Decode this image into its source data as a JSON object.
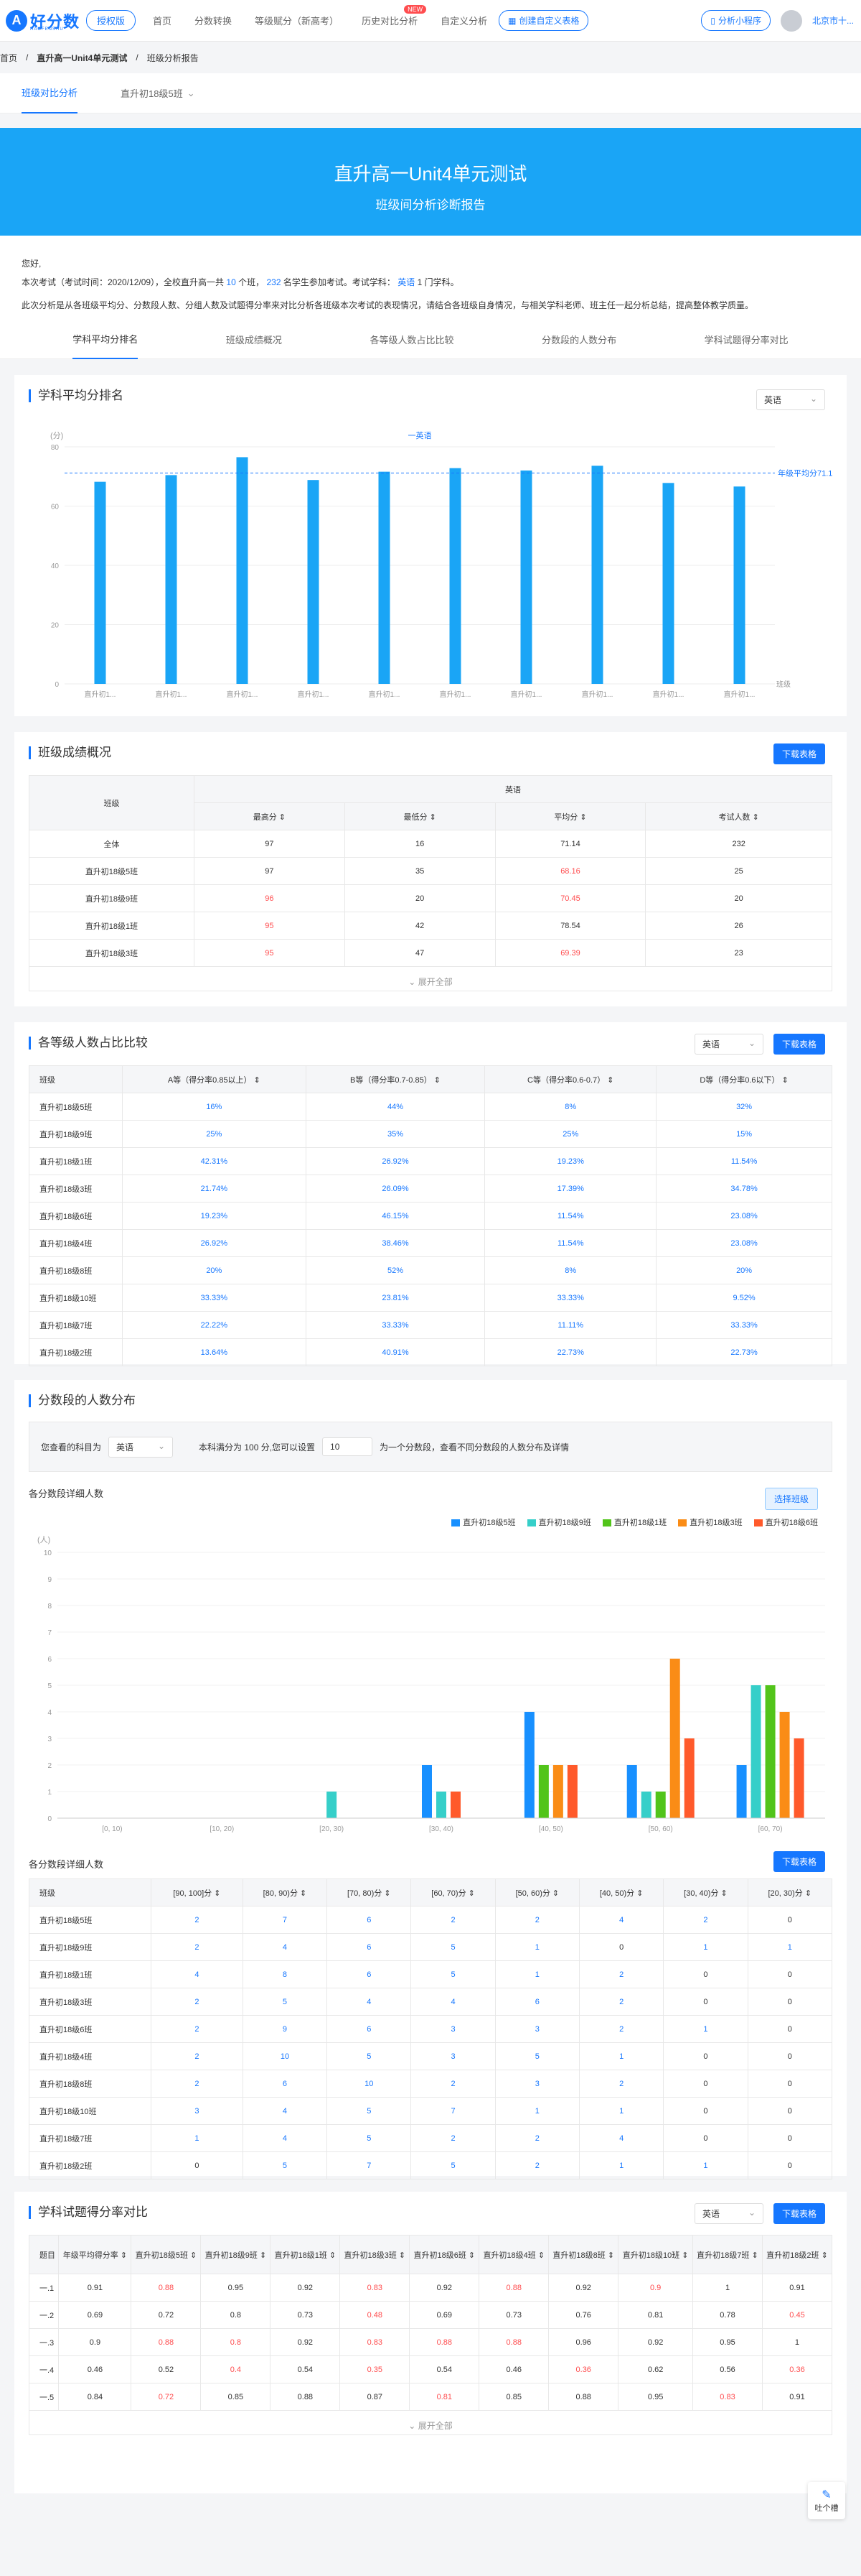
{
  "header": {
    "logo_text": "好分数",
    "logo_sub": "HAOFENSHU",
    "nav": [
      {
        "label": "授权版"
      },
      {
        "label": "首页"
      },
      {
        "label": "分数转换"
      },
      {
        "label": "等级赋分（新高考）"
      },
      {
        "label": "历史对比分析",
        "badge": "NEW"
      },
      {
        "label": "自定义分析"
      }
    ],
    "custom_report_btn": "创建自定义表格",
    "mini_program_btn": "分析小程序",
    "user_name": "北京市十..."
  },
  "breadcrumb": {
    "home": "首页",
    "exam": "直升高一Unit4单元测试",
    "current": "班级分析报告"
  },
  "subtabs": [
    {
      "label": "班级对比分析"
    },
    {
      "label": "直升初18级5班"
    }
  ],
  "hero": {
    "title": "直升高一Unit4单元测试",
    "subtitle": "班级间分析诊断报告"
  },
  "intro": {
    "greeting": "您好,",
    "line1_a": "本次考试（考试时间：2020/12/09），全校直升高一共",
    "classes": "10",
    "line1_b": "个班，",
    "students": "232",
    "line1_c": "名学生参加考试。考试学科：",
    "subject": "英语",
    "line1_d": "1 门学科。",
    "line2": "此次分析是从各班级平均分、分数段人数、分组人数及试题得分率来对比分析各班级本次考试的表现情况，请结合各班级自身情况，与相关学科老师、班主任一起分析总结，提高整体教学质量。"
  },
  "section_tabs": [
    {
      "label": "学科平均分排名"
    },
    {
      "label": "班级成绩概况"
    },
    {
      "label": "各等级人数占比比较"
    },
    {
      "label": "分数段的人数分布"
    },
    {
      "label": "学科试题得分率对比"
    }
  ],
  "avg_rank": {
    "title": "学科平均分排名",
    "select": "英语",
    "chart_data": {
      "type": "bar",
      "legend": "一英语",
      "ylabel": "(分)",
      "xlabel": "班级",
      "ylim": [
        0,
        80
      ],
      "yticks": [
        "0",
        "20",
        "40",
        "60",
        "80"
      ],
      "avg_label": "年级平均分71.14",
      "avg_value": 71.14,
      "categories": [
        "直升初1...",
        "直升初1...",
        "直升初1...",
        "直升初1...",
        "直升初1...",
        "直升初1...",
        "直升初1...",
        "直升初1...",
        "直升初1...",
        "直升初1..."
      ],
      "values": [
        68.2,
        70.45,
        76.5,
        68.8,
        71.6,
        72.8,
        72.0,
        73.6,
        67.8,
        66.6
      ],
      "color": "#1aa5f6"
    }
  },
  "overview": {
    "title": "班级成绩概况",
    "download": "下载表格",
    "subject": "英语",
    "headers": [
      "班级",
      "最高分",
      "最低分",
      "平均分",
      "考试人数"
    ],
    "rows": [
      {
        "name": "全体",
        "max": "97",
        "min": "16",
        "avg": "71.14",
        "count": "232"
      },
      {
        "name": "直升初18级5班",
        "max": "97",
        "min": "35",
        "avg": "68.16",
        "count": "25"
      },
      {
        "name": "直升初18级9班",
        "max": "96",
        "min": "20",
        "avg": "70.45",
        "count": "20"
      },
      {
        "name": "直升初18级1班",
        "max": "95",
        "min": "42",
        "avg": "78.54",
        "count": "26"
      },
      {
        "name": "直升初18级3班",
        "max": "95",
        "min": "47",
        "avg": "69.39",
        "count": "23"
      }
    ],
    "expand": "展开全部"
  },
  "levels": {
    "title": "各等级人数占比比较",
    "select": "英语",
    "download": "下载表格",
    "headers": [
      "班级",
      "A等（得分率0.85以上）",
      "B等（得分率0.7-0.85）",
      "C等（得分率0.6-0.7）",
      "D等（得分率0.6以下）"
    ],
    "rows": [
      [
        "直升初18级5班",
        "16%",
        "44%",
        "8%",
        "32%"
      ],
      [
        "直升初18级9班",
        "25%",
        "35%",
        "25%",
        "15%"
      ],
      [
        "直升初18级1班",
        "42.31%",
        "26.92%",
        "19.23%",
        "11.54%"
      ],
      [
        "直升初18级3班",
        "21.74%",
        "26.09%",
        "17.39%",
        "34.78%"
      ],
      [
        "直升初18级6班",
        "19.23%",
        "46.15%",
        "11.54%",
        "23.08%"
      ],
      [
        "直升初18级4班",
        "26.92%",
        "38.46%",
        "11.54%",
        "23.08%"
      ],
      [
        "直升初18级8班",
        "20%",
        "52%",
        "8%",
        "20%"
      ],
      [
        "直升初18级10班",
        "33.33%",
        "23.81%",
        "33.33%",
        "9.52%"
      ],
      [
        "直升初18级7班",
        "22.22%",
        "33.33%",
        "11.11%",
        "33.33%"
      ],
      [
        "直升初18级2班",
        "13.64%",
        "40.91%",
        "22.73%",
        "22.73%"
      ]
    ]
  },
  "distribution": {
    "title": "分数段的人数分布",
    "filter_a": "您查看的科目为",
    "filter_subject": "英语",
    "filter_b": "本科满分为 100 分,您可以设置",
    "filter_step": "10",
    "filter_c": "为一个分数段，查看不同分数段的人数分布及详情",
    "chart_title": "各分数段详细人数",
    "select_class_btn": "选择班级",
    "chart_data": {
      "type": "bar",
      "ylabel": "(人)",
      "ylim": [
        0,
        10
      ],
      "yticks": [
        "0",
        "1",
        "2",
        "3",
        "4",
        "5",
        "6",
        "7",
        "8",
        "9",
        "10"
      ],
      "categories": [
        "[0, 10)",
        "[10, 20)",
        "[20, 30)",
        "[30, 40)",
        "[40, 50)",
        "[50, 60)",
        "[60, 70)"
      ],
      "series": [
        {
          "name": "直升初18级5班",
          "color": "#1890ff",
          "values": [
            0,
            0,
            0,
            2,
            4,
            2,
            2
          ]
        },
        {
          "name": "直升初18级9班",
          "color": "#36cfc9",
          "values": [
            0,
            0,
            1,
            1,
            0,
            1,
            5
          ]
        },
        {
          "name": "直升初18级1班",
          "color": "#52c41a",
          "values": [
            0,
            0,
            0,
            0,
            2,
            1,
            5
          ]
        },
        {
          "name": "直升初18级3班",
          "color": "#fa8c16",
          "values": [
            0,
            0,
            0,
            0,
            2,
            6,
            4
          ]
        },
        {
          "name": "直升初18级6班",
          "color": "#ff5a2b",
          "values": [
            0,
            0,
            0,
            1,
            2,
            3,
            3
          ]
        }
      ]
    },
    "table_title": "各分数段详细人数",
    "download": "下载表格",
    "table_headers": [
      "班级",
      "[90, 100]分",
      "[80, 90)分",
      "[70, 80)分",
      "[60, 70)分",
      "[50, 60)分",
      "[40, 50)分",
      "[30, 40)分",
      "[20, 30)分"
    ],
    "table_rows": [
      [
        "直升初18级5班",
        "2",
        "7",
        "6",
        "2",
        "2",
        "4",
        "2",
        "0"
      ],
      [
        "直升初18级9班",
        "2",
        "4",
        "6",
        "5",
        "1",
        "0",
        "1",
        "1"
      ],
      [
        "直升初18级1班",
        "4",
        "8",
        "6",
        "5",
        "1",
        "2",
        "0",
        "0"
      ],
      [
        "直升初18级3班",
        "2",
        "5",
        "4",
        "4",
        "6",
        "2",
        "0",
        "0"
      ],
      [
        "直升初18级6班",
        "2",
        "9",
        "6",
        "3",
        "3",
        "2",
        "1",
        "0"
      ],
      [
        "直升初18级4班",
        "2",
        "10",
        "5",
        "3",
        "5",
        "1",
        "0",
        "0"
      ],
      [
        "直升初18级8班",
        "2",
        "6",
        "10",
        "2",
        "3",
        "2",
        "0",
        "0"
      ],
      [
        "直升初18级10班",
        "3",
        "4",
        "5",
        "7",
        "1",
        "1",
        "0",
        "0"
      ],
      [
        "直升初18级7班",
        "1",
        "4",
        "5",
        "2",
        "2",
        "4",
        "0",
        "0"
      ],
      [
        "直升初18级2班",
        "0",
        "5",
        "7",
        "5",
        "2",
        "1",
        "1",
        "0"
      ]
    ]
  },
  "question_rate": {
    "title": "学科试题得分率对比",
    "select": "英语",
    "download": "下载表格",
    "headers": [
      "题目",
      "年级平均得分率",
      "直升初18级5班",
      "直升初18级9班",
      "直升初18级1班",
      "直升初18级3班",
      "直升初18级6班",
      "直升初18级4班",
      "直升初18级8班",
      "直升初18级10班",
      "直升初18级7班",
      "直升初18级2班"
    ],
    "rows": [
      [
        "一.1",
        "0.91",
        "0.88",
        "0.95",
        "0.92",
        "0.83",
        "0.92",
        "0.88",
        "0.92",
        "0.9",
        "1",
        "0.91"
      ],
      [
        "一.2",
        "0.69",
        "0.72",
        "0.8",
        "0.73",
        "0.48",
        "0.69",
        "0.73",
        "0.76",
        "0.81",
        "0.78",
        "0.45"
      ],
      [
        "一.3",
        "0.9",
        "0.88",
        "0.8",
        "0.92",
        "0.83",
        "0.88",
        "0.88",
        "0.96",
        "0.92",
        "0.95",
        "1"
      ],
      [
        "一.4",
        "0.46",
        "0.52",
        "0.4",
        "0.54",
        "0.35",
        "0.54",
        "0.46",
        "0.36",
        "0.62",
        "0.56",
        "0.36"
      ],
      [
        "一.5",
        "0.84",
        "0.72",
        "0.85",
        "0.88",
        "0.87",
        "0.81",
        "0.85",
        "0.88",
        "0.95",
        "0.83",
        "0.91"
      ]
    ],
    "expand": "展开全部"
  },
  "floating": {
    "label": "吐个槽"
  }
}
